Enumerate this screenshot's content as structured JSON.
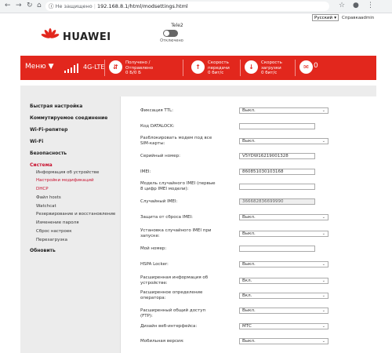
{
  "browser": {
    "security_label": "Не защищено",
    "url": "192.168.8.1/html/modsettings.html"
  },
  "top": {
    "lang": "Русский",
    "help": "Справка",
    "admin": "admin"
  },
  "brand": {
    "name": "HUAWEI"
  },
  "operator": {
    "name": "Tele2",
    "status": "Отключено"
  },
  "statusbar": {
    "menu": "Меню",
    "network": "4G-LTE",
    "received_label": "Получено /",
    "sent_label": "Отправлено",
    "traffic_value": "0 Б/0 Б",
    "upload_label": "Скорость",
    "upload_label2": "передачи",
    "upload_value": "0 бит/с",
    "download_label": "Скорость",
    "download_label2": "загрузки",
    "download_value": "0 бит/с",
    "messages": "0"
  },
  "sidebar": {
    "items": [
      "Быстрая настройка",
      "Коммутируемое соединение",
      "Wi-Fi-репитер",
      "Wi-Fi",
      "Безопасность",
      "Система"
    ],
    "sub": [
      "Информация об устройстве",
      "Настройки модификаций",
      "DHCP",
      "Файл hosts",
      "Watchcat",
      "Резервирование и восстановление",
      "Изменение пароля",
      "Сброс настроек",
      "Перезагрузка"
    ],
    "last": "Обновить"
  },
  "form": {
    "ttl_label": "Фиксация TTL:",
    "ttl_value": "Выкл.",
    "datalock_label": "Код DATALOCK:",
    "datalock_value": "",
    "simlock_label": "Разблокировать модем под все SIM-карты:",
    "simlock_value": "Выкл.",
    "serial_label": "Серийный номер:",
    "serial_value": "V5YDW16219001328",
    "imei_label": "IMEI:",
    "imei_value": "860851030103168",
    "randmodel_label": "Модель случайного IMEI (первые 8 цифр IMEI модели):",
    "randmodel_value": "",
    "randimei_label": "Случайный IMEI:",
    "randimei_value": "366682836699990",
    "protect_label": "Защита от сброса IMEI:",
    "protect_value": "Выкл.",
    "setrand_label": "Установка случайного IMEI при запуске:",
    "setrand_value": "Выкл.",
    "phone_label": "Мой номер:",
    "phone_value": "",
    "hspa_label": "HSPA Locker:",
    "hspa_value": "Выкл.",
    "extinfo_label": "Расширенная информация об устройстве:",
    "extinfo_value": "Вкл.",
    "extop_label": "Расширенное определение оператора:",
    "extop_value": "Вкл.",
    "ftp_label": "Расширенный общий доступ (FTP):",
    "ftp_value": "Выкл.",
    "theme_label": "Дизайн веб-интерфейса:",
    "theme_value": "МТС",
    "mobile_label": "Мобильная версия:",
    "mobile_value": "Выкл."
  }
}
